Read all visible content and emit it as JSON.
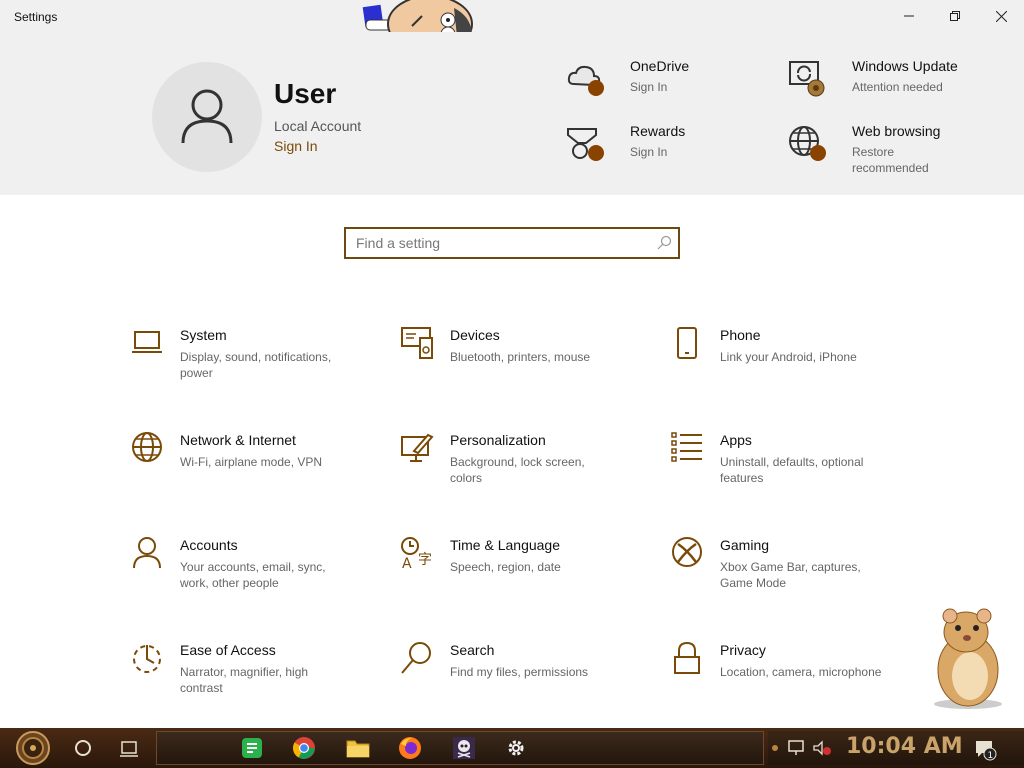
{
  "window": {
    "title": "Settings",
    "controls": {
      "minimize": "—",
      "maximize": "▢",
      "close": "✕"
    }
  },
  "user": {
    "name": "User",
    "account_type": "Local Account",
    "sign_in": "Sign In"
  },
  "quick_links": [
    {
      "title": "OneDrive",
      "subtitle": "Sign In",
      "icon": "cloud-icon"
    },
    {
      "title": "Windows Update",
      "subtitle": "Attention needed",
      "icon": "update-icon"
    },
    {
      "title": "Rewards",
      "subtitle": "Sign In",
      "icon": "medal-icon"
    },
    {
      "title": "Web browsing",
      "subtitle": "Restore recommended",
      "icon": "globe-icon"
    }
  ],
  "search": {
    "placeholder": "Find a setting"
  },
  "categories": [
    {
      "title": "System",
      "subtitle": "Display, sound, notifications, power",
      "icon": "laptop-icon"
    },
    {
      "title": "Devices",
      "subtitle": "Bluetooth, printers, mouse",
      "icon": "devices-icon"
    },
    {
      "title": "Phone",
      "subtitle": "Link your Android, iPhone",
      "icon": "phone-icon"
    },
    {
      "title": "Network & Internet",
      "subtitle": "Wi-Fi, airplane mode, VPN",
      "icon": "globe-icon"
    },
    {
      "title": "Personalization",
      "subtitle": "Background, lock screen, colors",
      "icon": "paintbrush-icon"
    },
    {
      "title": "Apps",
      "subtitle": "Uninstall, defaults, optional features",
      "icon": "apps-list-icon"
    },
    {
      "title": "Accounts",
      "subtitle": "Your accounts, email, sync, work, other people",
      "icon": "person-icon"
    },
    {
      "title": "Time & Language",
      "subtitle": "Speech, region, date",
      "icon": "time-language-icon"
    },
    {
      "title": "Gaming",
      "subtitle": "Xbox Game Bar, captures, Game Mode",
      "icon": "xbox-icon"
    },
    {
      "title": "Ease of Access",
      "subtitle": "Narrator, magnifier, high contrast",
      "icon": "ease-of-access-icon"
    },
    {
      "title": "Search",
      "subtitle": "Find my files, permissions",
      "icon": "search-icon"
    },
    {
      "title": "Privacy",
      "subtitle": "Location, camera, microphone",
      "icon": "lock-icon"
    }
  ],
  "taskbar": {
    "apps": [
      "start-icon",
      "cortana-icon",
      "task-view-icon",
      "chat-app-icon",
      "chrome-icon",
      "file-explorer-icon",
      "firefox-icon",
      "skull-app-icon",
      "settings-gear-icon"
    ],
    "clock": "10:04 AM",
    "notification_count": "1"
  },
  "colors": {
    "accent": "#7a4a08",
    "dot": "#8a4200",
    "header_bg": "#f0f0f0"
  }
}
